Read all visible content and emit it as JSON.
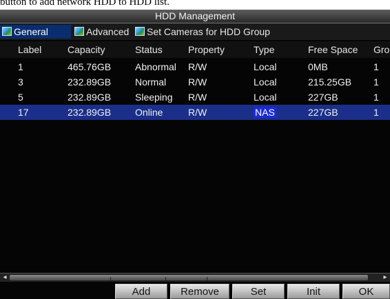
{
  "caption": "button to add network HDD to HDD list.",
  "window": {
    "title": "HDD Management"
  },
  "tabs": [
    {
      "label": "General",
      "icon": "picture-icon",
      "active": true
    },
    {
      "label": "Advanced",
      "icon": "picture-icon",
      "active": false
    },
    {
      "label": "Set Cameras for HDD Group",
      "icon": "picture-icon",
      "active": false
    }
  ],
  "table": {
    "columns": [
      "Label",
      "Capacity",
      "Status",
      "Property",
      "Type",
      "Free Space",
      "Group"
    ],
    "rows": [
      {
        "checked": false,
        "label": "1",
        "capacity": "465.76GB",
        "status": "Abnormal",
        "property": "R/W",
        "type": "Local",
        "free_space": "0MB",
        "group": "1"
      },
      {
        "checked": false,
        "label": "3",
        "capacity": "232.89GB",
        "status": "Normal",
        "property": "R/W",
        "type": "Local",
        "free_space": "215.25GB",
        "group": "1"
      },
      {
        "checked": false,
        "label": "5",
        "capacity": "232.89GB",
        "status": "Sleeping",
        "property": "R/W",
        "type": "Local",
        "free_space": "227GB",
        "group": "1"
      },
      {
        "checked": true,
        "label": "17",
        "capacity": "232.89GB",
        "status": "Online",
        "property": "R/W",
        "type": "NAS",
        "free_space": "227GB",
        "group": "1"
      }
    ],
    "selected_row": "17"
  },
  "buttons": {
    "add": "Add",
    "remove": "Remove",
    "set": "Set",
    "init": "Init",
    "ok": "OK"
  },
  "colors": {
    "selection": "#1b2f8a",
    "tab_active": "#0a2d6e",
    "background": "#050505"
  }
}
